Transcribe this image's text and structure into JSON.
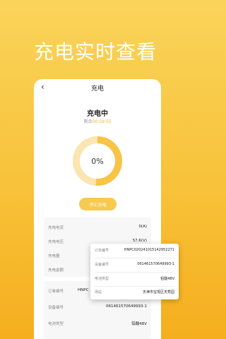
{
  "hero": {
    "title": "充电实时查看"
  },
  "nav": {
    "back_icon": "‹",
    "title": "充电"
  },
  "status": {
    "title": "充电中",
    "remaining_label": "剩余",
    "remaining_time": "00:59:55"
  },
  "progress": {
    "percent_text": "0%",
    "fill_fraction": 0.51,
    "fill_color": "#f8c445",
    "track_color": "#fbe5b0"
  },
  "stop_button": {
    "label": "停止充电"
  },
  "metrics": [
    {
      "label": "充电电流",
      "value": "0(A)"
    },
    {
      "label": "充电电压",
      "value": "57.6(V)"
    },
    {
      "label": "充电量",
      "value": ""
    },
    {
      "label": "充电金额",
      "value": ""
    }
  ],
  "order": [
    {
      "label": "订单编号",
      "value": "HNPC"
    },
    {
      "label": "设备编号",
      "value": "061461570649993-1"
    },
    {
      "label": "电池类型",
      "value": "铅酸48V"
    }
  ],
  "popup": [
    {
      "label": "订单编号",
      "value": "HNPC020241015142952271"
    },
    {
      "label": "设备编号",
      "value": "061461570649993-1"
    },
    {
      "label": "电池类型",
      "value": "铅酸48V"
    },
    {
      "label": "场站",
      "value": "天津市宝坻区天秀园"
    }
  ],
  "colors": {
    "accent": "#f8c445",
    "bg_top": "#fad45a",
    "bg_bottom": "#f5ae1d"
  }
}
